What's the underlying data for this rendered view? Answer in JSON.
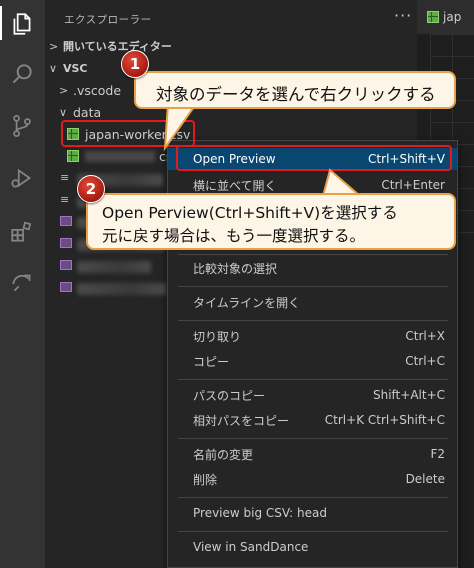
{
  "sidebar": {
    "title": "エクスプローラー",
    "more": "···",
    "open_editors": "開いているエディター",
    "root": "VSC",
    "items": [
      {
        "label": ".vscode"
      },
      {
        "label": "data"
      },
      {
        "label": "japan-worker.csv"
      },
      {
        "label": "csv"
      }
    ]
  },
  "editor": {
    "tab_label": "jap"
  },
  "context_menu": {
    "items": [
      {
        "label": "Open Preview",
        "shortcut": "Ctrl+Shift+V"
      },
      {
        "label": "横に並べて開く",
        "shortcut": "Ctrl+Enter"
      },
      {
        "label": "比較対象の選択",
        "shortcut": ""
      },
      {
        "label": "タイムラインを開く",
        "shortcut": ""
      },
      {
        "label": "切り取り",
        "shortcut": "Ctrl+X"
      },
      {
        "label": "コピー",
        "shortcut": "Ctrl+C"
      },
      {
        "label": "パスのコピー",
        "shortcut": "Shift+Alt+C"
      },
      {
        "label": "相対パスをコピー",
        "shortcut": "Ctrl+K Ctrl+Shift+C"
      },
      {
        "label": "名前の変更",
        "shortcut": "F2"
      },
      {
        "label": "削除",
        "shortcut": "Delete"
      },
      {
        "label": "Preview big CSV: head",
        "shortcut": ""
      },
      {
        "label": "View in SandDance",
        "shortcut": ""
      }
    ]
  },
  "annotations": {
    "step1": {
      "number": "1",
      "text": "対象のデータを選んで右クリックする"
    },
    "step2": {
      "number": "2",
      "line1": "Open  Perview(Ctrl+Shift+V)を選択する",
      "line2": "元に戻す場合は、もう一度選択する。"
    }
  },
  "colors": {
    "activity_bar": "#333333",
    "sidebar_bg": "#252526",
    "menu_highlight": "#094771",
    "annotation_red": "#e01b1b",
    "callout_bg": "#fdf5e6",
    "callout_border": "#e8a14b"
  }
}
